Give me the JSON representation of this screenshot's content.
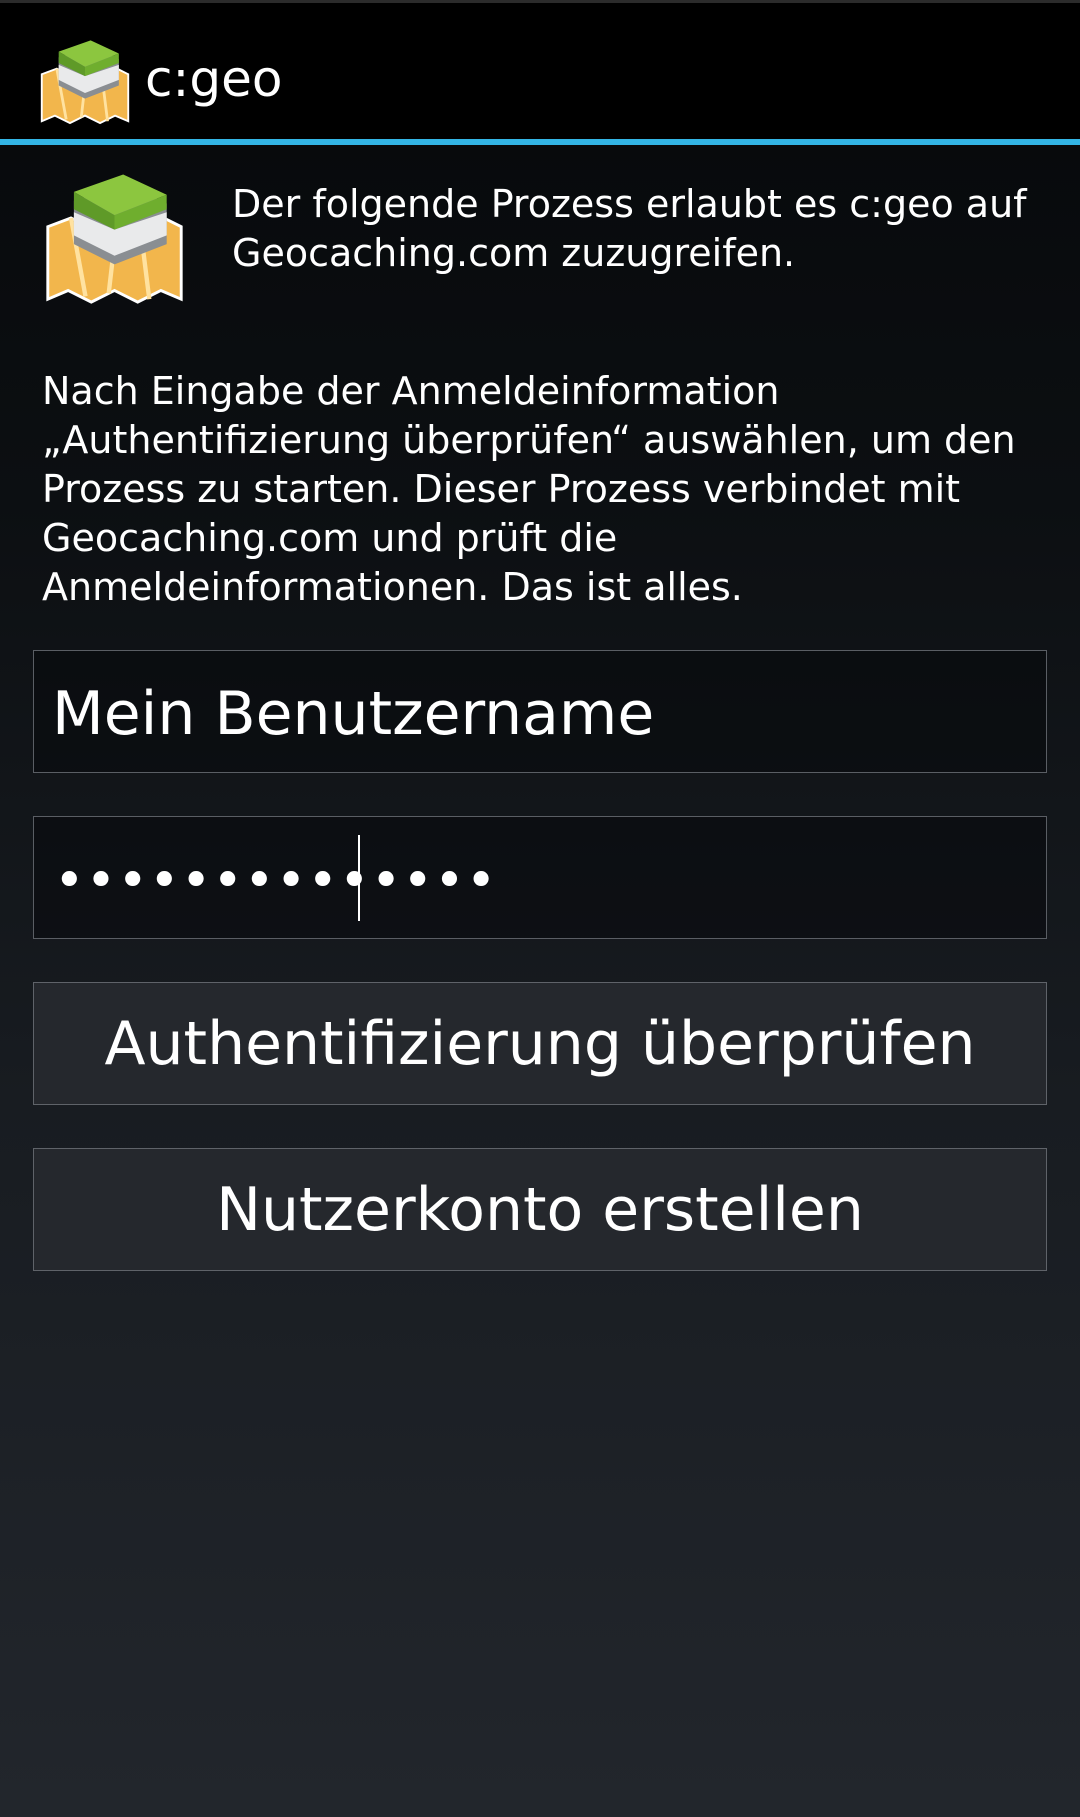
{
  "app": {
    "title": "c:geo",
    "icon": "cgeo-logo-icon"
  },
  "intro": {
    "text": "Der folgende Prozess erlaubt es c:geo auf Geocaching.com zuzugreifen."
  },
  "info": {
    "text": "Nach Eingabe der Anmeldeinformation „Authentifizierung überprüfen“ auswählen, um den Prozess zu starten. Dieser Prozess verbindet mit Geocaching.com und prüft die Anmeldeinformationen. Das ist alles."
  },
  "form": {
    "username_value": "Mein Benutzername",
    "password_value": "••••••••••••••"
  },
  "buttons": {
    "check_auth_label": "Authentifizierung überprüfen",
    "create_account_label": "Nutzerkonto erstellen"
  },
  "colors": {
    "accent": "#33b5e5",
    "actionbar": "#000000",
    "button_bg": "#25282d"
  }
}
